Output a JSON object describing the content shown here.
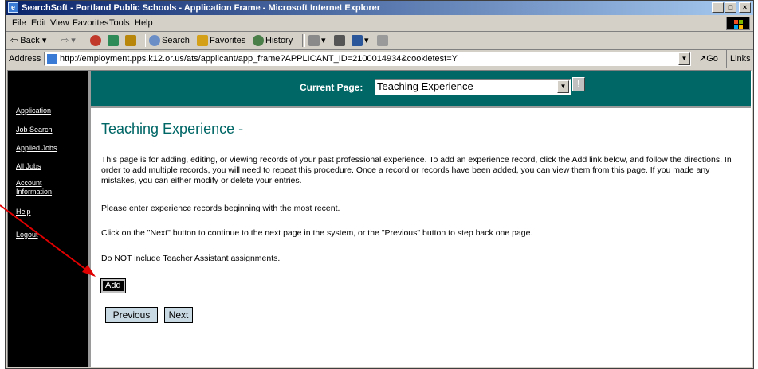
{
  "window": {
    "title": "SearchSoft - Portland Public Schools - Application Frame - Microsoft Internet Explorer",
    "minimize": "_",
    "maximize": "0",
    "close": "×"
  },
  "menu": [
    "File",
    "Edit",
    "View",
    "Favorites",
    "Tools",
    "Help"
  ],
  "toolbar": {
    "back": "Back",
    "search": "Search",
    "favorites": "Favorites",
    "history": "History"
  },
  "address": {
    "label": "Address",
    "url": "http://employment.pps.k12.or.us/ats/applicant/app_frame?APPLICANT_ID=2100014934&cookietest=Y",
    "go": "Go",
    "links": "Links"
  },
  "sidebar": {
    "items": [
      {
        "label": "Application"
      },
      {
        "label": "Job Search"
      },
      {
        "label": "Applied Jobs"
      },
      {
        "label": "All Jobs"
      },
      {
        "label": "Account Information"
      },
      {
        "label": "Help"
      },
      {
        "label": "Logout"
      }
    ]
  },
  "header": {
    "current_page_label": "Current Page:",
    "current_page_value": "Teaching Experience",
    "help_glyph": "!"
  },
  "main": {
    "title": "Teaching Experience -",
    "paragraphs": [
      "This page is for adding, editing, or viewing records of your past professional experience. To add an experience record, click the Add link below, and follow the directions. In order to add multiple records, you will need to repeat this procedure. Once a record or records have been added, you can view them from this page. If you made any mistakes, you can either modify or delete your entries.",
      "Please enter experience records beginning with the most recent.",
      "Click on the \"Next\" button to continue to the next page in the system, or the \"Previous\" button to step back one page.",
      "Do NOT include Teacher Assistant assignments."
    ],
    "add_label": "Add",
    "previous_label": "Previous",
    "next_label": "Next"
  },
  "colors": {
    "header_teal": "#006666",
    "sidebar_black": "#000000",
    "annotation_arrow": "#e00000"
  }
}
